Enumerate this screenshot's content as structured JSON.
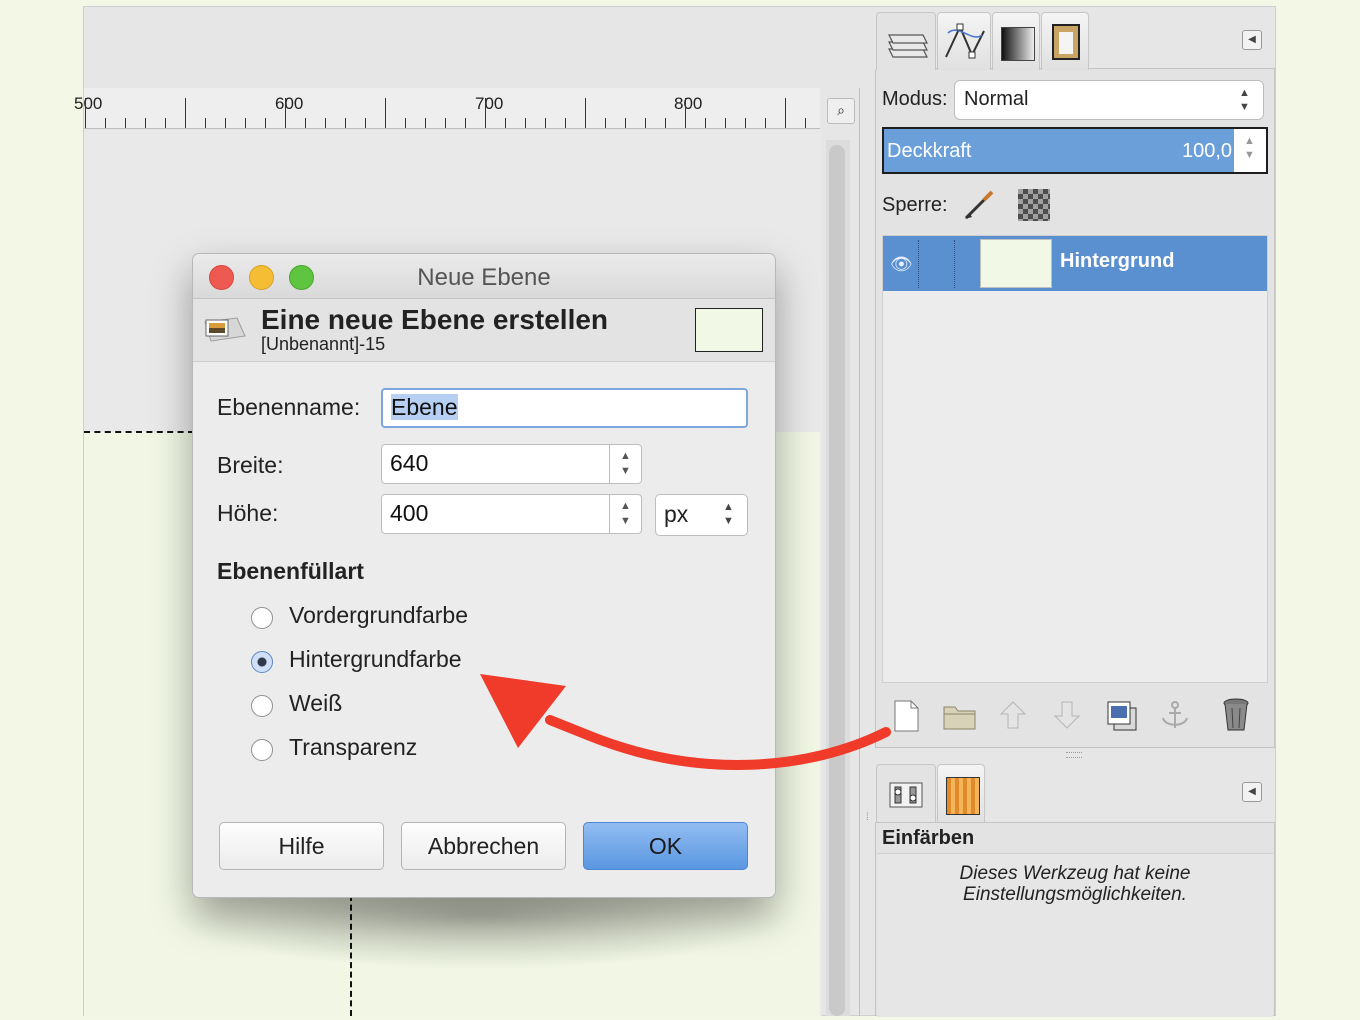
{
  "ruler": {
    "labels": [
      "500",
      "600",
      "700",
      "800"
    ]
  },
  "dialog": {
    "title": "Neue Ebene",
    "header_title": "Eine neue Ebene erstellen",
    "header_subtitle": "[Unbenannt]-15",
    "fields": {
      "name_label": "Ebenenname:",
      "name_value": "Ebene",
      "width_label": "Breite:",
      "width_value": "640",
      "height_label": "Höhe:",
      "height_value": "400",
      "unit": "px"
    },
    "fill": {
      "heading": "Ebenenfüllart",
      "options": [
        {
          "label": "Vordergrundfarbe",
          "selected": false
        },
        {
          "label": "Hintergrundfarbe",
          "selected": true
        },
        {
          "label": "Weiß",
          "selected": false
        },
        {
          "label": "Transparenz",
          "selected": false
        }
      ]
    },
    "buttons": {
      "help": "Hilfe",
      "cancel": "Abbrechen",
      "ok": "OK"
    }
  },
  "layers_panel": {
    "mode_label": "Modus:",
    "mode_value": "Normal",
    "opacity_label": "Deckkraft",
    "opacity_value": "100,0",
    "lock_label": "Sperre:",
    "layers": [
      {
        "name": "Hintergrund",
        "visible": true,
        "selected": true
      }
    ]
  },
  "tool_options": {
    "title": "Einfärben",
    "message_line1": "Dieses Werkzeug hat keine",
    "message_line2": "Einstellungsmöglichkeiten."
  },
  "colors": {
    "selection_blue": "#5b90d0",
    "ok_button": "#5a97e2",
    "arrow_red": "#f03a2a",
    "layer_fill": "#f1f8e5"
  },
  "icons": [
    "new-layer-icon",
    "open-folder-icon",
    "raise-layer-icon",
    "lower-layer-icon",
    "duplicate-layer-icon",
    "anchor-icon",
    "delete-layer-icon"
  ]
}
